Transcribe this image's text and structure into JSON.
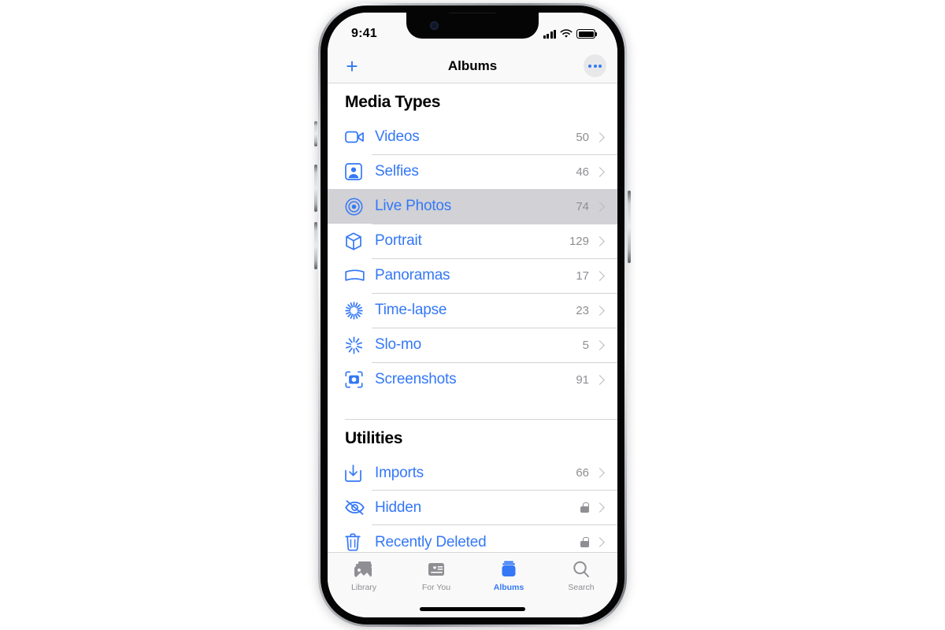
{
  "status_bar": {
    "time": "9:41",
    "signal_icon": "cellular-bars-icon",
    "wifi_icon": "wifi-icon",
    "battery_icon": "battery-full-icon"
  },
  "nav_bar": {
    "add_label": "+",
    "title": "Albums",
    "more_label": "•••"
  },
  "sections": [
    {
      "title": "Media Types",
      "rows": [
        {
          "label": "Videos",
          "count": "50",
          "icon": "video-camera-icon",
          "selected": false
        },
        {
          "label": "Selfies",
          "count": "46",
          "icon": "person-square-icon",
          "selected": false
        },
        {
          "label": "Live Photos",
          "count": "74",
          "icon": "live-photo-icon",
          "selected": true
        },
        {
          "label": "Portrait",
          "count": "129",
          "icon": "cube-icon",
          "selected": false
        },
        {
          "label": "Panoramas",
          "count": "17",
          "icon": "panorama-icon",
          "selected": false
        },
        {
          "label": "Time-lapse",
          "count": "23",
          "icon": "timelapse-icon",
          "selected": false
        },
        {
          "label": "Slo-mo",
          "count": "5",
          "icon": "slomo-icon",
          "selected": false
        },
        {
          "label": "Screenshots",
          "count": "91",
          "icon": "screenshot-icon",
          "selected": false
        }
      ]
    },
    {
      "title": "Utilities",
      "rows": [
        {
          "label": "Imports",
          "count": "66",
          "icon": "import-icon",
          "selected": false,
          "locked": false
        },
        {
          "label": "Hidden",
          "count": "",
          "icon": "eye-slash-icon",
          "selected": false,
          "locked": true
        },
        {
          "label": "Recently Deleted",
          "count": "",
          "icon": "trash-icon",
          "selected": false,
          "locked": true
        }
      ]
    }
  ],
  "tab_bar": {
    "tabs": [
      {
        "label": "Library",
        "icon": "photos-stack-icon",
        "active": false
      },
      {
        "label": "For You",
        "icon": "for-you-card-icon",
        "active": false
      },
      {
        "label": "Albums",
        "icon": "albums-book-icon",
        "active": true
      },
      {
        "label": "Search",
        "icon": "magnifier-icon",
        "active": false
      }
    ]
  },
  "colors": {
    "accent": "#3478f6",
    "selected_row_bg": "#d1d1d6",
    "secondary_text": "#8e8e93",
    "chrome_bg": "#f9f9f9"
  }
}
